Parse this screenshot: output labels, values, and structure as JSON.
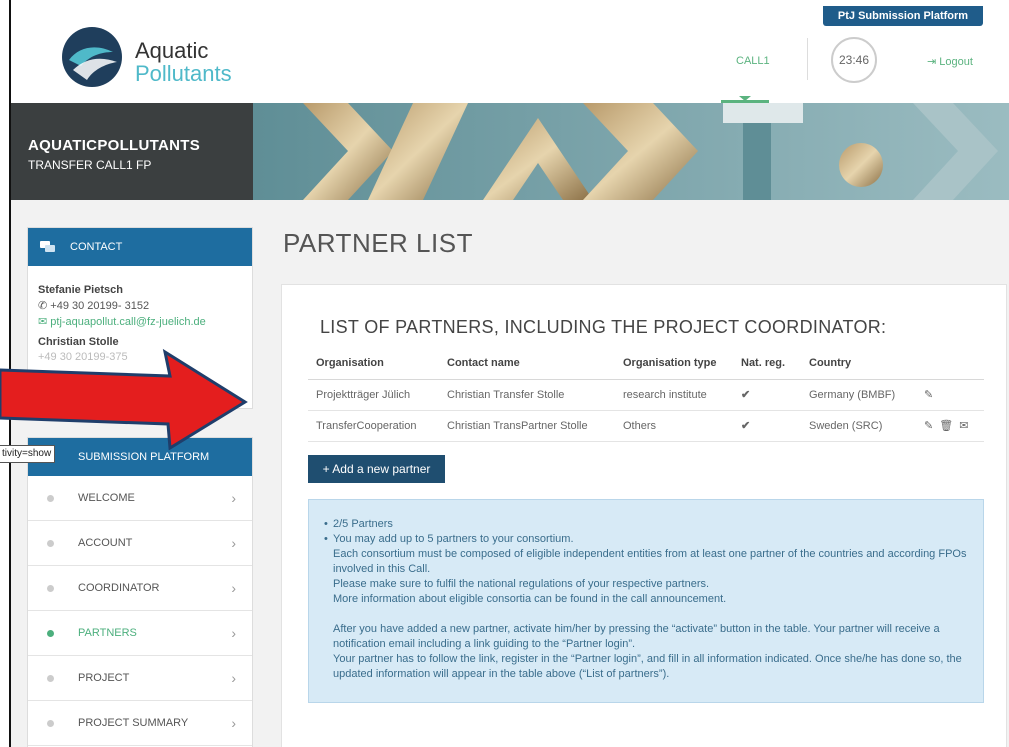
{
  "header": {
    "logo_line1": "Aquatic",
    "logo_line2": "Pollutants",
    "platform_label": "PtJ Submission Platform",
    "call_label": "CALL1",
    "timer": "23:46",
    "logout_label": "Logout"
  },
  "banner": {
    "title": "AQUATICPOLLUTANTS",
    "subtitle": "TRANSFER CALL1 FP"
  },
  "contact": {
    "heading": "CONTACT",
    "name1": "Stefanie Pietsch",
    "phone1": "+49 30 20199- 3152",
    "email1": "ptj-aquapollut.call@fz-juelich.de",
    "name2": "Christian Stolle",
    "phone2": "+49 30 20199-375"
  },
  "tooltip": "tivity=show",
  "nav": {
    "heading": "SUBMISSION PLATFORM",
    "items": [
      {
        "label": "WELCOME",
        "active": false
      },
      {
        "label": "ACCOUNT",
        "active": false
      },
      {
        "label": "COORDINATOR",
        "active": false
      },
      {
        "label": "PARTNERS",
        "active": true
      },
      {
        "label": "PROJECT",
        "active": false
      },
      {
        "label": "PROJECT SUMMARY",
        "active": false
      }
    ]
  },
  "main": {
    "page_title": "PARTNER LIST",
    "section_title": "LIST OF PARTNERS, INCLUDING THE PROJECT COORDINATOR:",
    "columns": [
      "Organisation",
      "Contact name",
      "Organisation type",
      "Nat. reg.",
      "Country"
    ],
    "rows": [
      {
        "organisation": "Projektträger Jülich",
        "contact": "Christian Transfer Stolle",
        "type": "research institute",
        "natreg": "✔",
        "country": "Germany (BMBF)",
        "actions": [
          "edit-icon"
        ]
      },
      {
        "organisation": "TransferCooperation",
        "contact": "Christian TransPartner Stolle",
        "type": "Others",
        "natreg": "✔",
        "country": "Sweden (SRC)",
        "actions": [
          "edit-icon",
          "delete-icon",
          "mail-icon"
        ]
      }
    ],
    "add_button": "+ Add a new partner",
    "info": {
      "count": "2/5 Partners",
      "line1": "You may add up to 5 partners to your consortium.",
      "line2": "Each consortium must be composed of eligible independent entities from at least one partner of the countries and according FPOs involved in this Call.",
      "line3": "Please make sure to fulfil the national regulations of your respective partners.",
      "line4": "More information about eligible consortia can be found in the call announcement.",
      "line5": "After you have added a new partner, activate him/her by pressing the “activate” button in the table. Your partner will receive a notification email including a link guiding to the “Partner login”.",
      "line6": "Your partner has to follow the link, register in the “Partner login”, and fill in all information indicated. Once she/he has done so, the updated information will appear in the table above (“List of partners”)."
    }
  },
  "colors": {
    "primary_blue": "#1e6da0",
    "dark_button": "#1f4e70",
    "green": "#4caf7d",
    "info_bg": "#d7eaf6",
    "arrow_red": "#e41e1e"
  }
}
